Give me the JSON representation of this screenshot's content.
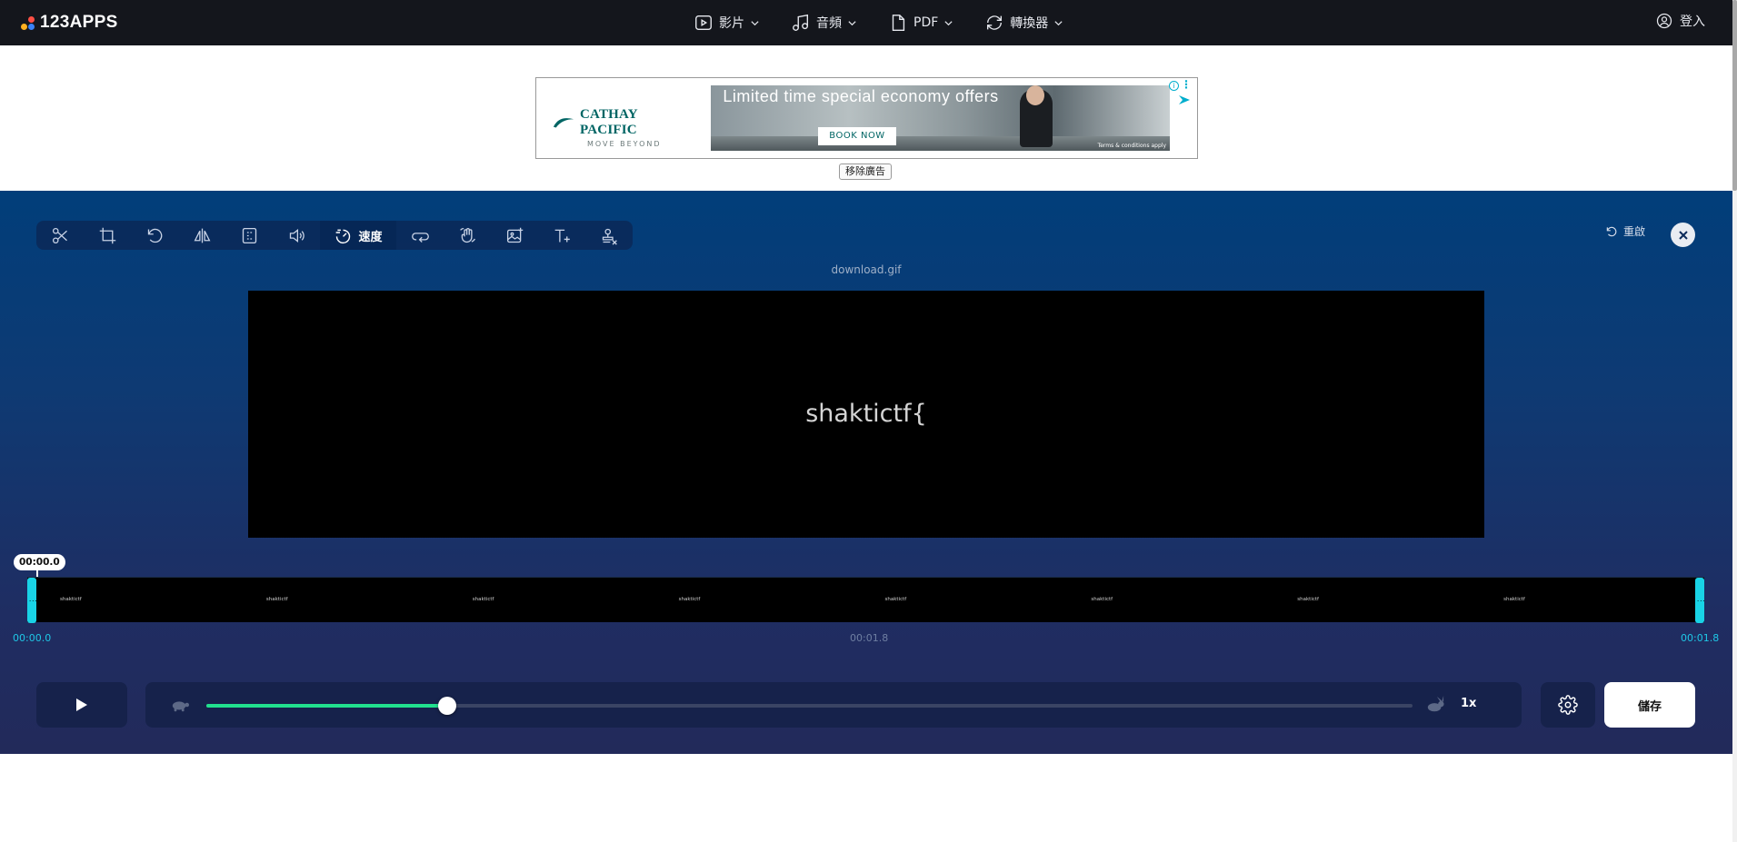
{
  "topbar": {
    "logo": "123APPS",
    "menu": [
      {
        "label": "影片",
        "icon": "video-icon"
      },
      {
        "label": "音頻",
        "icon": "music-icon"
      },
      {
        "label": "PDF",
        "icon": "document-icon"
      },
      {
        "label": "轉換器",
        "icon": "convert-icon"
      }
    ],
    "login": "登入"
  },
  "ad": {
    "brand": "CATHAY PACIFIC",
    "tagline": "MOVE BEYOND",
    "headline": "Limited time special economy offers",
    "cta": "BOOK NOW",
    "terms": "Terms & conditions apply",
    "info": "i",
    "remove": "移除廣告"
  },
  "editor": {
    "tools": [
      "cut-icon",
      "crop-icon",
      "rotate-icon",
      "flip-icon",
      "resize-icon",
      "volume-icon",
      "speed-icon",
      "loop-icon",
      "stabilize-icon",
      "image-icon",
      "text-icon",
      "remove-logo-icon"
    ],
    "active_tool_label": "速度",
    "reset": "重啟",
    "filename": "download.gif",
    "preview_text": "shaktictf{",
    "timeline": {
      "current": "00:00.0",
      "start": "00:00.0",
      "middle": "00:01.8",
      "end": "00:01.8",
      "frame_text": "shaktictf",
      "frame_count": 8
    },
    "speed": {
      "value_label": "1x",
      "fraction": 0.2
    },
    "save": "儲存"
  },
  "colors": {
    "accent": "#19d3e6",
    "slider": "#21e08e",
    "nav_bg": "#14161c"
  }
}
